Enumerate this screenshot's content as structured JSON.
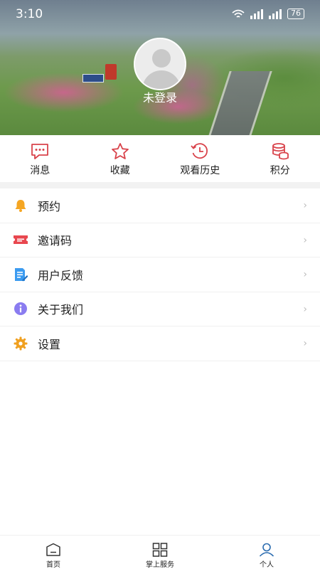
{
  "status_bar": {
    "time": "3:10",
    "battery": "76"
  },
  "profile": {
    "login_label": "未登录"
  },
  "shortcuts": [
    {
      "label": "消息",
      "icon": "message-icon"
    },
    {
      "label": "收藏",
      "icon": "star-icon"
    },
    {
      "label": "观看历史",
      "icon": "history-clock-icon"
    },
    {
      "label": "积分",
      "icon": "points-coins-icon"
    }
  ],
  "menu": [
    {
      "label": "预约",
      "icon": "bell-icon",
      "chevron": "›"
    },
    {
      "label": "邀请码",
      "icon": "ticket-icon",
      "chevron": "›"
    },
    {
      "label": "用户反馈",
      "icon": "feedback-doc-icon",
      "chevron": "›"
    },
    {
      "label": "关于我们",
      "icon": "info-icon",
      "chevron": "›"
    },
    {
      "label": "设置",
      "icon": "gear-icon",
      "chevron": "›"
    }
  ],
  "bottom_nav": [
    {
      "label": "首页",
      "icon": "home-icon"
    },
    {
      "label": "掌上服务",
      "icon": "grid-icon"
    },
    {
      "label": "个人",
      "icon": "person-icon",
      "active": true
    }
  ],
  "colors": {
    "accent_red": "#d9434b",
    "nav_active": "#2b6cb0"
  }
}
